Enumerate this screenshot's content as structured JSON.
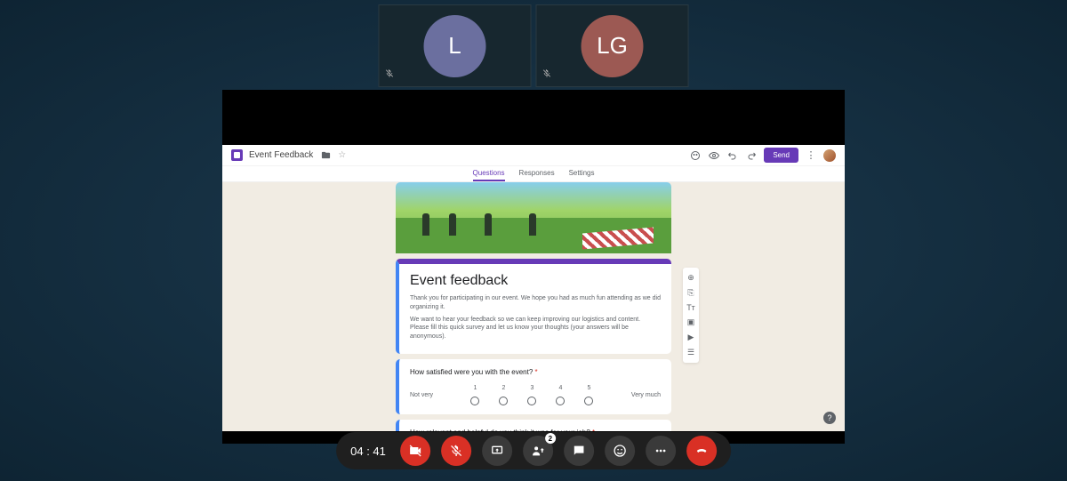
{
  "participants": [
    {
      "initials": "L",
      "color": "#6b6f9f",
      "muted": true
    },
    {
      "initials": "LG",
      "color": "#9c5953",
      "muted": true
    }
  ],
  "shared_screen": {
    "forms_toolbar": {
      "title": "Event Feedback",
      "star_tooltip": "Star",
      "send_label": "Send"
    },
    "tabs": {
      "questions": "Questions",
      "responses": "Responses",
      "settings": "Settings",
      "active": "Questions"
    },
    "form": {
      "header_title": "Event feedback",
      "header_desc1": "Thank you for participating in our event. We hope you had as much fun attending as we did organizing it.",
      "header_desc2": "We want to hear your feedback so we can keep improving our logistics and content. Please fill this quick survey and let us know your thoughts (your answers will be anonymous).",
      "q1": {
        "text": "How satisfied were you with the event?",
        "low_label": "Not very",
        "high_label": "Very much",
        "scale": [
          "1",
          "2",
          "3",
          "4",
          "5"
        ]
      },
      "q2": {
        "text": "How relevant and helpful do you think it was for your job?"
      }
    },
    "side_tools": {
      "add_question": "add-circle-icon",
      "import": "import-icon",
      "title_tool": "Tᴛ",
      "image_tool": "image-icon",
      "video_tool": "video-icon",
      "section_tool": "section-icon"
    }
  },
  "meeting_bar": {
    "time": "04 : 41",
    "participant_count": "2"
  },
  "required_marker": " *"
}
